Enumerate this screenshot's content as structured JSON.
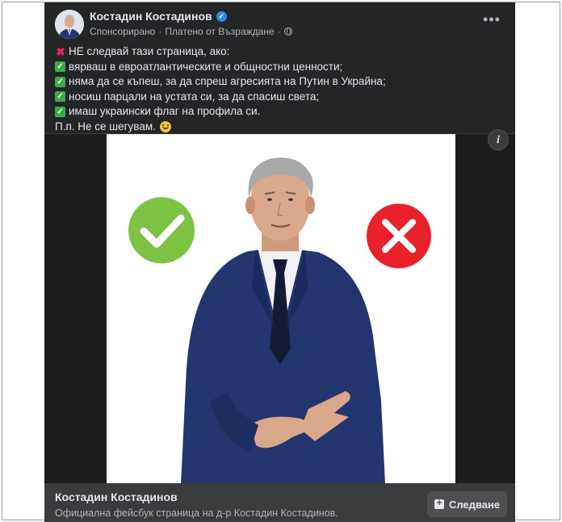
{
  "post": {
    "author": "Костадин Костадинов",
    "meta_sponsored": "Спонсорирано",
    "meta_separator": "·",
    "meta_paid_by": "Платено от Възраждане",
    "icons": {
      "verified": "verified-badge-icon",
      "globe": "globe-icon",
      "more": "more-options-icon",
      "cross": "red-cross-emoji-icon",
      "check": "green-check-emoji-icon",
      "smile": "smile-emoji-icon",
      "info": "info-icon",
      "follow": "add-page-icon"
    },
    "text": {
      "line1": "НЕ следвай тази страница, ако:",
      "line2": "вярваш в евроатлантическите и общностни ценности;",
      "line3": "няма да се къпеш, за да спреш агресията на Путин в Украйна;",
      "line4": "носиш парцали на устата си, за да спасиш света;",
      "line5": "имаш украински флаг на профила си.",
      "line6": "П.п. Не се шегувам."
    }
  },
  "image": {
    "left_symbol": "check",
    "right_symbol": "cross",
    "check_color": "#7dc242",
    "cross_color": "#e8212b",
    "suit_color": "#23356f"
  },
  "footer": {
    "page_name": "Костадин Костадинов",
    "page_description": "Официална фейсбук страница на д-р Костадин Костадинов.",
    "follow_label": "Следване"
  },
  "colors": {
    "card_bg": "#242526",
    "text_primary": "#e4e6eb",
    "text_secondary": "#b0b3b8",
    "verified_blue": "#2d88ff"
  }
}
